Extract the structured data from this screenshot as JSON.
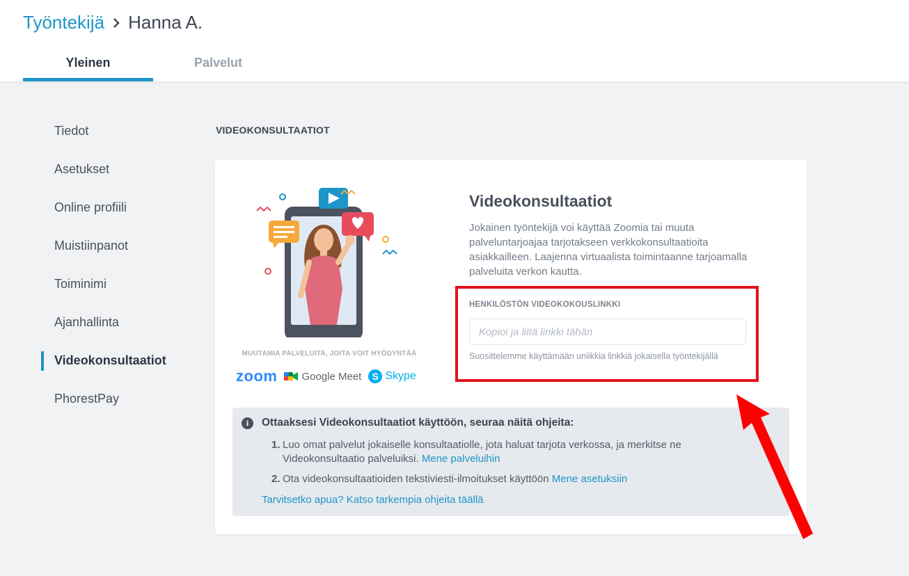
{
  "header": {
    "breadcrumb_parent": "Työntekijä",
    "breadcrumb_current": "Hanna A.",
    "tabs": [
      {
        "label": "Yleinen",
        "active": true
      },
      {
        "label": "Palvelut",
        "active": false
      }
    ]
  },
  "sidebar": {
    "items": [
      {
        "label": "Tiedot"
      },
      {
        "label": "Asetukset"
      },
      {
        "label": "Online profiili"
      },
      {
        "label": "Muistiinpanot"
      },
      {
        "label": "Toiminimi"
      },
      {
        "label": "Ajanhallinta"
      },
      {
        "label": "Videokonsultaatiot",
        "active": true
      },
      {
        "label": "PhorestPay"
      }
    ]
  },
  "main": {
    "section_title": "VIDEOKONSULTAATIOT",
    "services_caption": "MUUTAMIA PALVELUITA, JOITA VOIT HYÖDYNTÄÄ",
    "logos": {
      "zoom": "zoom",
      "meet": "Google Meet",
      "skype": "Skype",
      "skype_badge": "S"
    },
    "title": "Videokonsultaatiot",
    "description": "Jokainen työntekijä voi käyttää Zoomia tai muuta palveluntarjoajaa tarjotakseen verkkokonsultaatioita asiakkailleen. Laajenna virtuaalista toimintaanne tarjoamalla palveluita verkon kautta.",
    "field_label": "HENKILÖSTÖN VIDEOKOKOUSLINKKI",
    "field_placeholder": "Kopioi ja liitä linkki tähän",
    "field_value": "",
    "field_hint": "Suosittelemme käyttämään uniikkia linkkiä jokaisella työntekijällä",
    "info": {
      "icon": "i",
      "title": "Ottaaksesi Videokonsultaatiot käyttöön, seuraa näitä ohjeita:",
      "steps": [
        {
          "num": "1.",
          "text": "Luo omat palvelut jokaiselle konsultaatiolle, jota haluat tarjota verkossa, ja merkitse ne Videokonsultaatio palveluiksi.",
          "link": "Mene palveluihin"
        },
        {
          "num": "2.",
          "text": "Ota videokonsultaatioiden tekstiviesti-ilmoitukset käyttöön",
          "link": "Mene asetuksiin"
        }
      ],
      "help_link": "Tarvitsetko apua? Katso tarkempia ohjeita täällä"
    }
  },
  "colors": {
    "accent": "#1e95c9",
    "highlight_box": "#e3131c",
    "arrow": "#ff0000",
    "zoom": "#2d8cff",
    "skype": "#00aff0"
  }
}
